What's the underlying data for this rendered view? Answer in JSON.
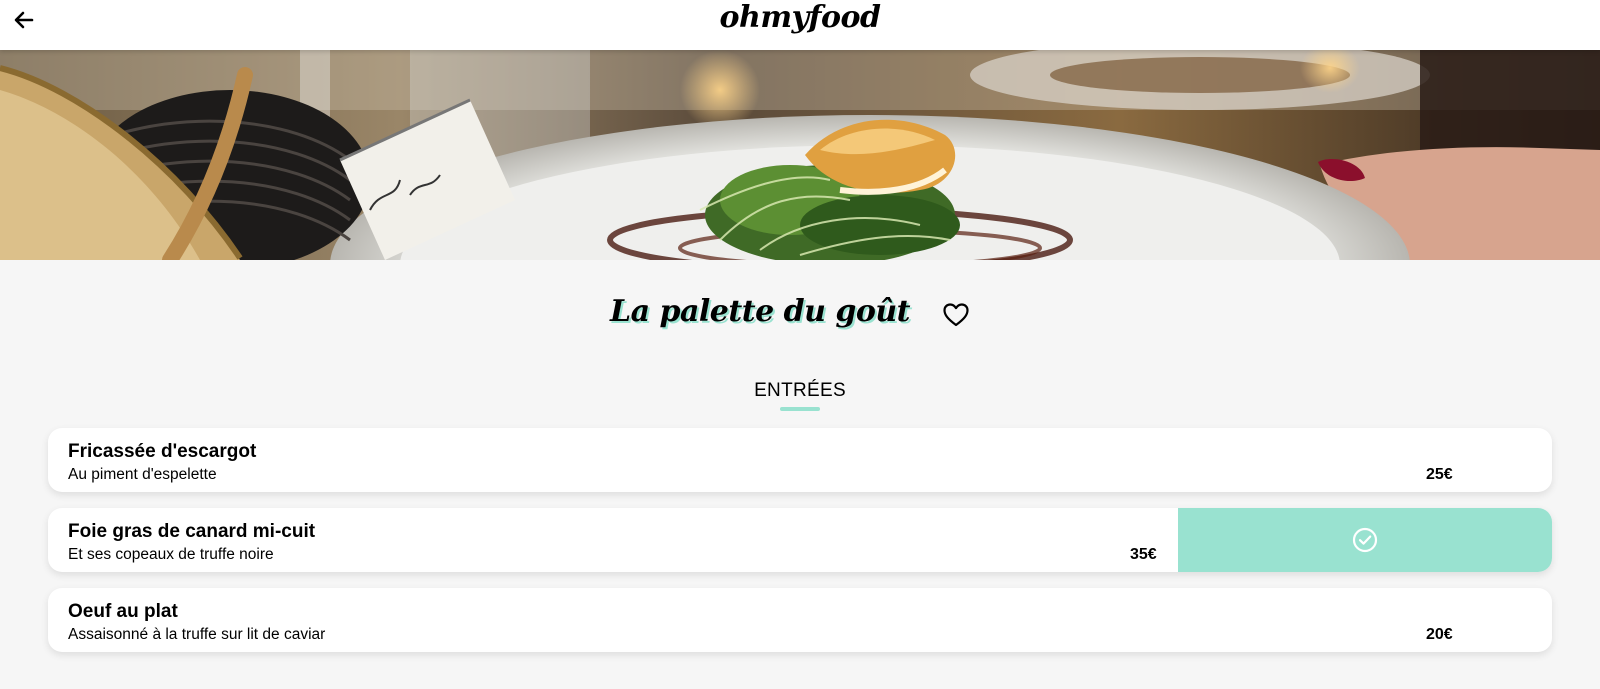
{
  "header": {
    "logo_text": "ohmyfood",
    "back_icon": "arrow-left-icon"
  },
  "hero": {
    "image_subject": "plated fish with micro greens on a white plate, bread basket, restaurant table"
  },
  "restaurant": {
    "title": "La palette du goût",
    "favorite_icon": "heart-outline-icon"
  },
  "menu": {
    "section_title": "ENTRÉES",
    "accent_color": "#99e2d0",
    "items": [
      {
        "name": "Fricassée d'escargot",
        "description": "Au piment d'espelette",
        "price": "25€",
        "selected": false
      },
      {
        "name": "Foie gras de canard mi-cuit",
        "description": "Et ses copeaux de truffe noire",
        "price": "35€",
        "selected": true,
        "check_icon": "check-circle-icon"
      },
      {
        "name": "Oeuf au plat",
        "description": "Assaisonné à la truffe sur lit de caviar",
        "price": "20€",
        "selected": false
      }
    ]
  }
}
